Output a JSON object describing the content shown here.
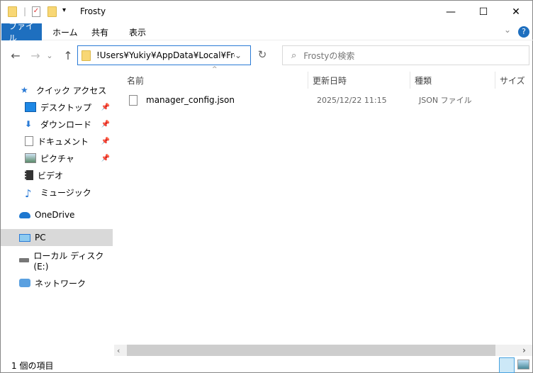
{
  "window": {
    "title": "Frosty",
    "minimize": "—",
    "maximize": "☐",
    "close": "✕"
  },
  "ribbon": {
    "tabs": [
      "ファイル",
      "ホーム",
      "共有",
      "表示"
    ],
    "expand": "⌄",
    "help": "?"
  },
  "address": {
    "path": "!Users¥Yukiy¥AppData¥Local¥Frosty",
    "dropdown": "⌄",
    "refresh": "↻"
  },
  "search": {
    "placeholder": "Frostyの検索"
  },
  "nav": {
    "back": "←",
    "forward": "→",
    "recent": "⌄",
    "up": "↑"
  },
  "sidebar": {
    "items": [
      {
        "label": "クイック アクセス"
      },
      {
        "label": "デスクトップ",
        "pinned": true
      },
      {
        "label": "ダウンロード",
        "pinned": true
      },
      {
        "label": "ドキュメント",
        "pinned": true
      },
      {
        "label": "ピクチャ",
        "pinned": true
      },
      {
        "label": "ビデオ"
      },
      {
        "label": "ミュージック"
      },
      {
        "label": "OneDrive"
      },
      {
        "label": "PC",
        "selected": true
      },
      {
        "label": "ローカル ディスク (E:)"
      },
      {
        "label": "ネットワーク"
      }
    ]
  },
  "columns": {
    "name": "名前",
    "date": "更新日時",
    "type": "種類",
    "size": "サイズ"
  },
  "files": [
    {
      "name": "manager_config.json",
      "date": "2025/12/22 11:15",
      "type": "JSON ファイル"
    }
  ],
  "status": {
    "count": "1 個の項目"
  }
}
